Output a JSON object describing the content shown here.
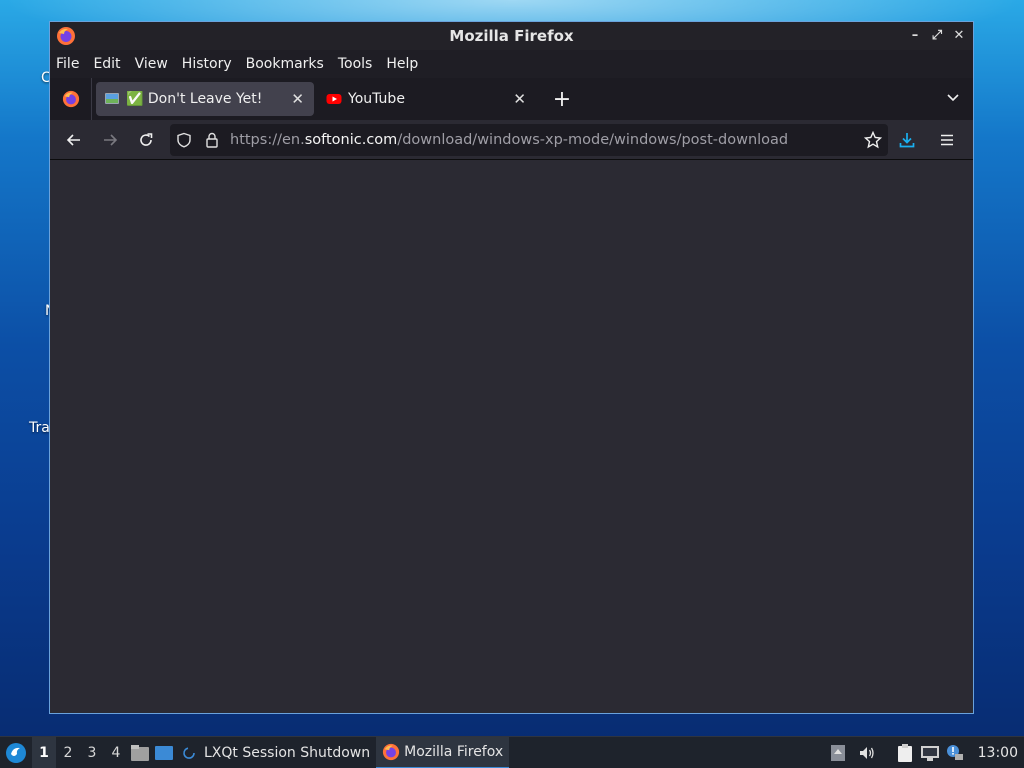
{
  "window": {
    "title": "Mozilla Firefox"
  },
  "desktop": {
    "labels": [
      "C",
      "N",
      "Tra"
    ]
  },
  "menubar": {
    "items": [
      {
        "label": "File"
      },
      {
        "label": "Edit"
      },
      {
        "label": "View"
      },
      {
        "label": "History"
      },
      {
        "label": "Bookmarks"
      },
      {
        "label": "Tools"
      },
      {
        "label": "Help"
      }
    ]
  },
  "tabs": [
    {
      "label": "✅ Don't Leave Yet!",
      "active": true
    },
    {
      "label": "YouTube",
      "active": false
    }
  ],
  "navbar": {
    "url_prefix": "https://en.",
    "url_domain": "softonic.com",
    "url_path": "/download/windows-xp-mode/windows/post-download"
  },
  "taskbar": {
    "desktops": [
      "1",
      "2",
      "3",
      "4"
    ],
    "tasks": [
      {
        "label": "LXQt Session Shutdown"
      },
      {
        "label": "Mozilla Firefox"
      }
    ],
    "clock": "13:00"
  },
  "colors": {
    "accent": "#3b8ad6",
    "window_border": "#6aa2dc",
    "download_icon": "#1ab0f0"
  }
}
